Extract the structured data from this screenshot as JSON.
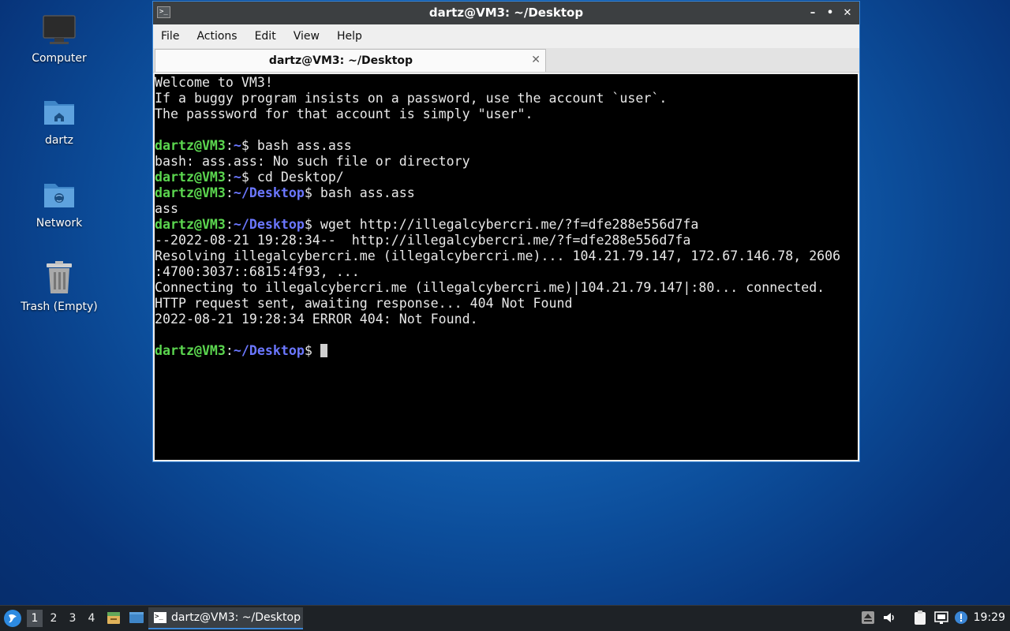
{
  "desktop": {
    "icons": [
      {
        "label": "Computer"
      },
      {
        "label": "dartz"
      },
      {
        "label": "Network"
      },
      {
        "label": "Trash (Empty)"
      }
    ]
  },
  "window": {
    "title": "dartz@VM3: ~/Desktop",
    "controls": {
      "minimize": "–",
      "maximize": "•",
      "close": "✕"
    },
    "menu": [
      "File",
      "Actions",
      "Edit",
      "View",
      "Help"
    ],
    "tab": {
      "label": "dartz@VM3: ~/Desktop",
      "close": "✕"
    }
  },
  "terminal": {
    "user": "dartz@VM3",
    "lines": [
      {
        "text": "Welcome to VM3!"
      },
      {
        "text": "If a buggy program insists on a password, use the account `user`."
      },
      {
        "text": "The passsword for that account is simply \"user\"."
      },
      {
        "text": ""
      },
      {
        "prompt": true,
        "path": "~",
        "cmd": "bash ass.ass"
      },
      {
        "text": "bash: ass.ass: No such file or directory"
      },
      {
        "prompt": true,
        "path": "~",
        "cmd": "cd Desktop/"
      },
      {
        "prompt": true,
        "path": "~/Desktop",
        "cmd": "bash ass.ass"
      },
      {
        "text": "ass"
      },
      {
        "prompt": true,
        "path": "~/Desktop",
        "cmd": "wget http://illegalcybercri.me/?f=dfe288e556d7fa"
      },
      {
        "text": "--2022-08-21 19:28:34--  http://illegalcybercri.me/?f=dfe288e556d7fa"
      },
      {
        "text": "Resolving illegalcybercri.me (illegalcybercri.me)... 104.21.79.147, 172.67.146.78, 2606"
      },
      {
        "text": ":4700:3037::6815:4f93, ..."
      },
      {
        "text": "Connecting to illegalcybercri.me (illegalcybercri.me)|104.21.79.147|:80... connected."
      },
      {
        "text": "HTTP request sent, awaiting response... 404 Not Found"
      },
      {
        "text": "2022-08-21 19:28:34 ERROR 404: Not Found."
      },
      {
        "text": ""
      },
      {
        "prompt": true,
        "path": "~/Desktop",
        "cmd": "",
        "cursor": true
      }
    ]
  },
  "taskbar": {
    "workspaces": [
      "1",
      "2",
      "3",
      "4"
    ],
    "active_workspace": "1",
    "task_label": "dartz@VM3: ~/Desktop",
    "clock": "19:29"
  }
}
